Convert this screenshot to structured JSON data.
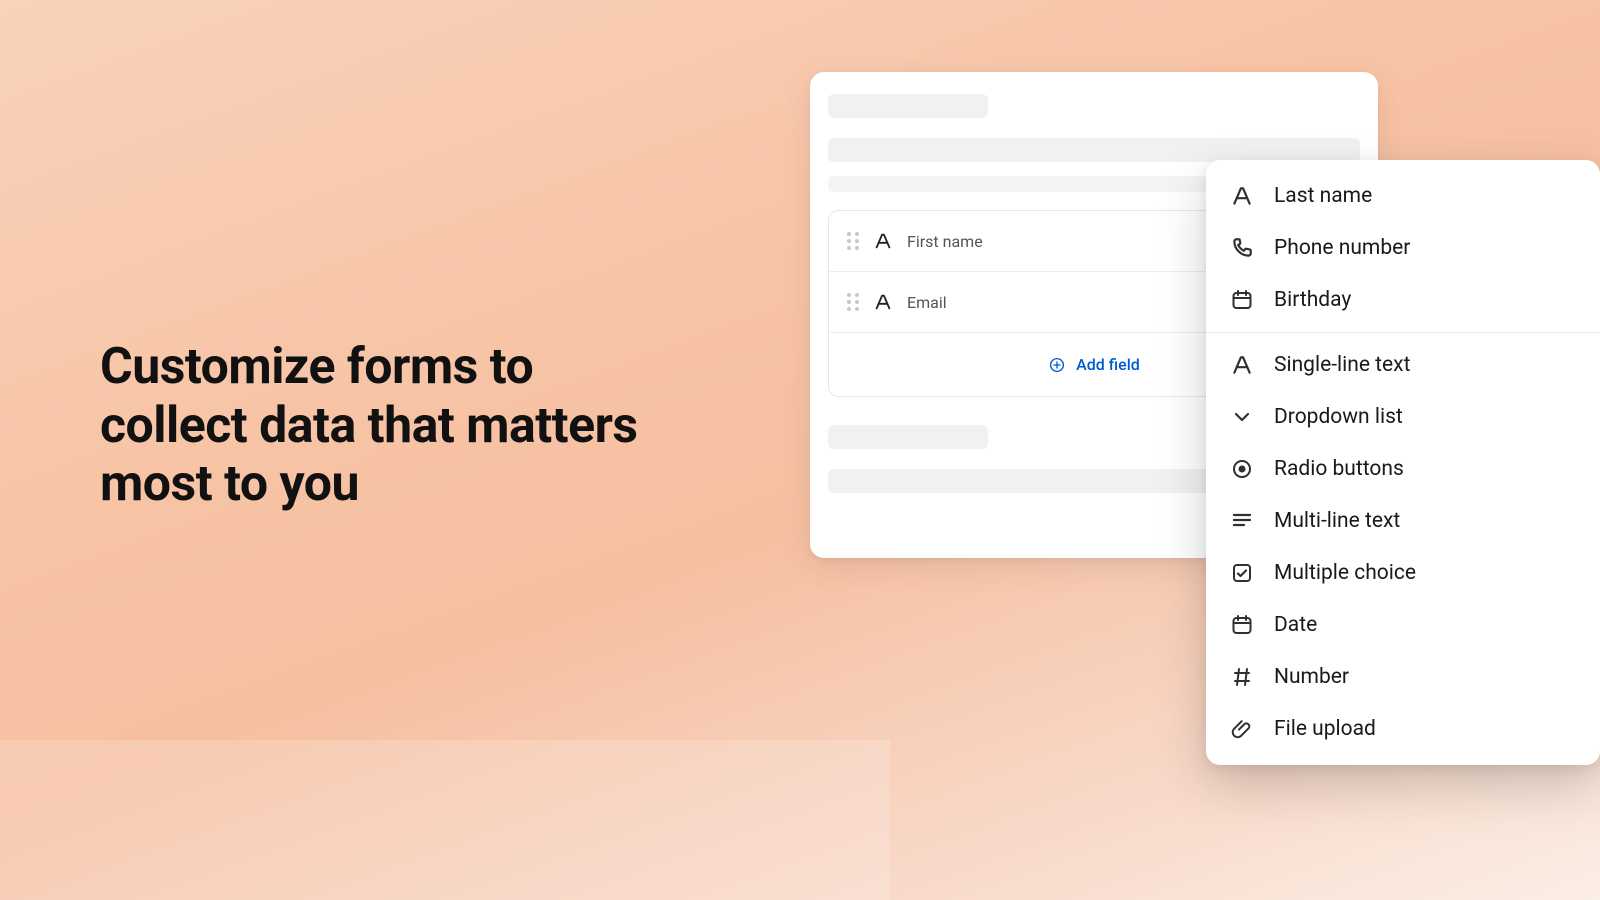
{
  "headline": "Customize forms to collect data that matters most to you",
  "form": {
    "fields": [
      {
        "label": "First name",
        "icon": "text"
      },
      {
        "label": "Email",
        "icon": "text"
      }
    ],
    "add_field_label": "Add field"
  },
  "field_menu": {
    "group1": [
      {
        "label": "Last name",
        "icon": "text"
      },
      {
        "label": "Phone number",
        "icon": "phone"
      },
      {
        "label": "Birthday",
        "icon": "date"
      }
    ],
    "group2": [
      {
        "label": "Single-line text",
        "icon": "text"
      },
      {
        "label": "Dropdown list",
        "icon": "chevron"
      },
      {
        "label": "Radio buttons",
        "icon": "radio"
      },
      {
        "label": "Multi-line text",
        "icon": "multiline"
      },
      {
        "label": "Multiple choice",
        "icon": "checkbox"
      },
      {
        "label": "Date",
        "icon": "date"
      },
      {
        "label": "Number",
        "icon": "number"
      },
      {
        "label": "File upload",
        "icon": "attachment"
      }
    ]
  },
  "colors": {
    "accent": "#005bd3",
    "text": "#1a1a1a",
    "muted_bg": "#f1f1f1"
  }
}
